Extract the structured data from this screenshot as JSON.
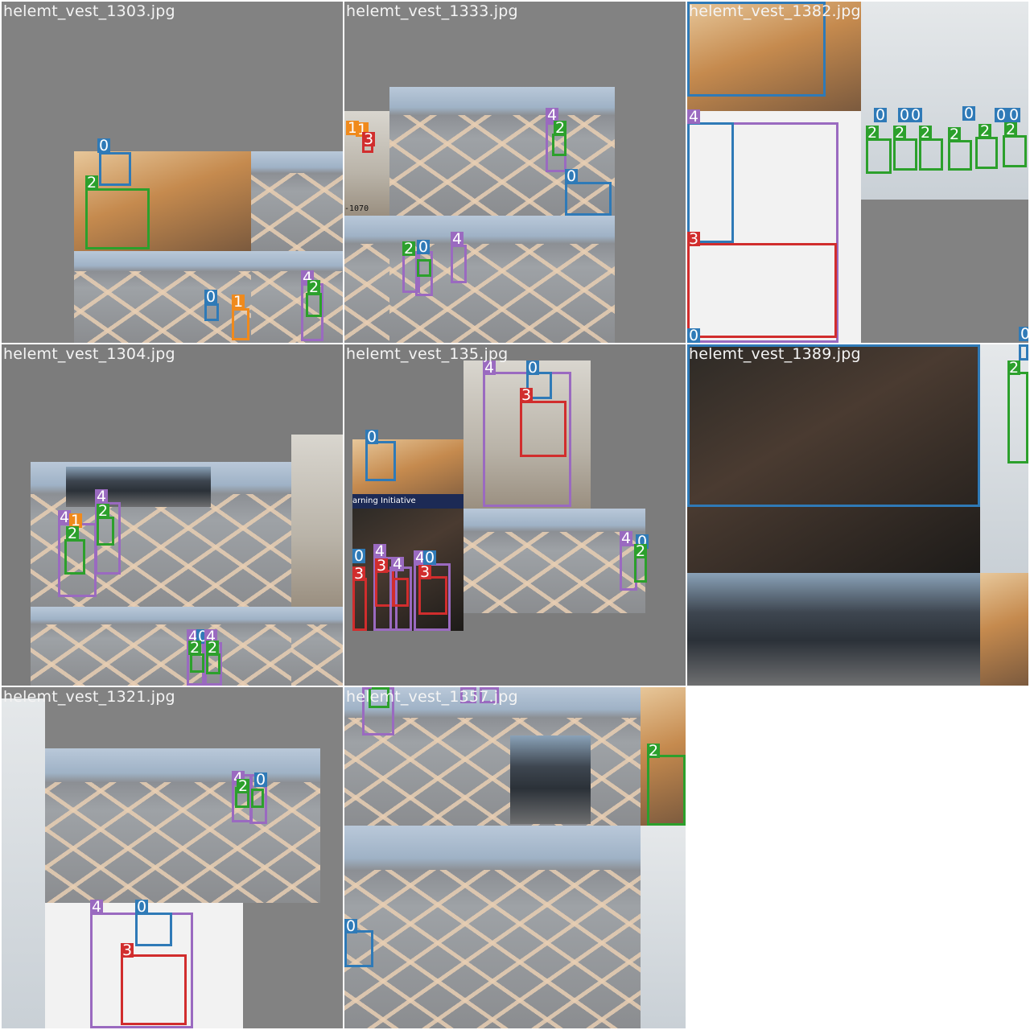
{
  "tiles": [
    {
      "title": "helemt_vest_1303.jpg"
    },
    {
      "title": "helemt_vest_1333.jpg"
    },
    {
      "title": "helemt_vest_1382.jpg"
    },
    {
      "title": "helemt_vest_1304.jpg"
    },
    {
      "title": "helemt_vest_135.jpg"
    },
    {
      "title": "helemt_vest_1389.jpg"
    },
    {
      "title": "helemt_vest_1321.jpg"
    },
    {
      "title": "helemt_vest_1357.jpg"
    }
  ],
  "photo_text": {
    "banner": "arning Initiative",
    "code": "-1070"
  },
  "class_colors": {
    "0": "#2f7ab7",
    "1": "#f08a1c",
    "2": "#2ca02c",
    "3": "#d12d2d",
    "4": "#9a6ac0"
  },
  "labels": {
    "c0": "0",
    "c1": "1",
    "c2": "2",
    "c3": "3",
    "c4": "4"
  }
}
